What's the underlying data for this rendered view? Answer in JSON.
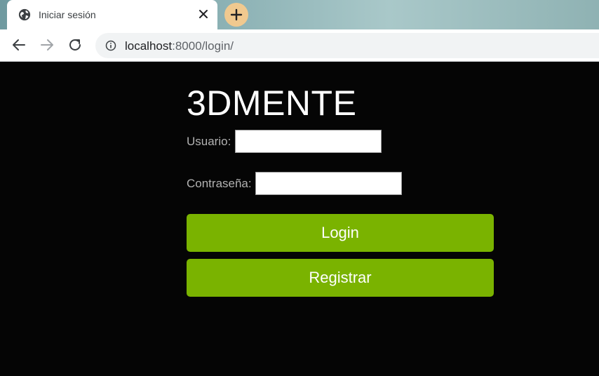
{
  "browser": {
    "tab_title": "Iniciar sesión",
    "url_host": "localhost",
    "url_path": ":8000/login/"
  },
  "page": {
    "brand": "3DMENTE",
    "username_label": "Usuario:",
    "username_value": "",
    "password_label": "Contraseña:",
    "password_value": "",
    "login_button": "Login",
    "register_button": "Registrar"
  },
  "colors": {
    "accent_green": "#7ab300",
    "background": "#050505",
    "newtab_badge": "#f0c98f"
  },
  "icons": [
    "globe-icon",
    "close-icon",
    "plus-icon",
    "back-arrow-icon",
    "forward-arrow-icon",
    "reload-icon",
    "info-icon"
  ]
}
